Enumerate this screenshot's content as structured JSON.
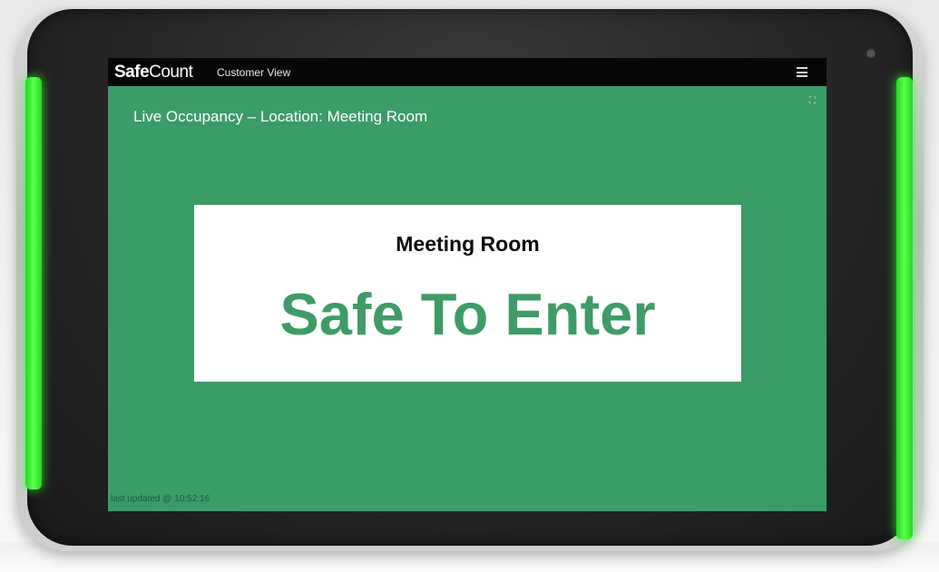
{
  "app": {
    "brand_strong": "Safe",
    "brand_light": "Count",
    "view_label": "Customer View"
  },
  "occupancy": {
    "title": "Live Occupancy – Location: Meeting Room",
    "room_name": "Meeting Room",
    "status": "Safe To Enter",
    "last_updated": "last updated @ 10:52:16"
  },
  "icons": {
    "menu": "hamburger-menu-icon",
    "expand": "fullscreen-icon"
  },
  "colors": {
    "status_background": "#3a9c67",
    "status_text": "#3f9b68",
    "led": "#33ff33"
  }
}
